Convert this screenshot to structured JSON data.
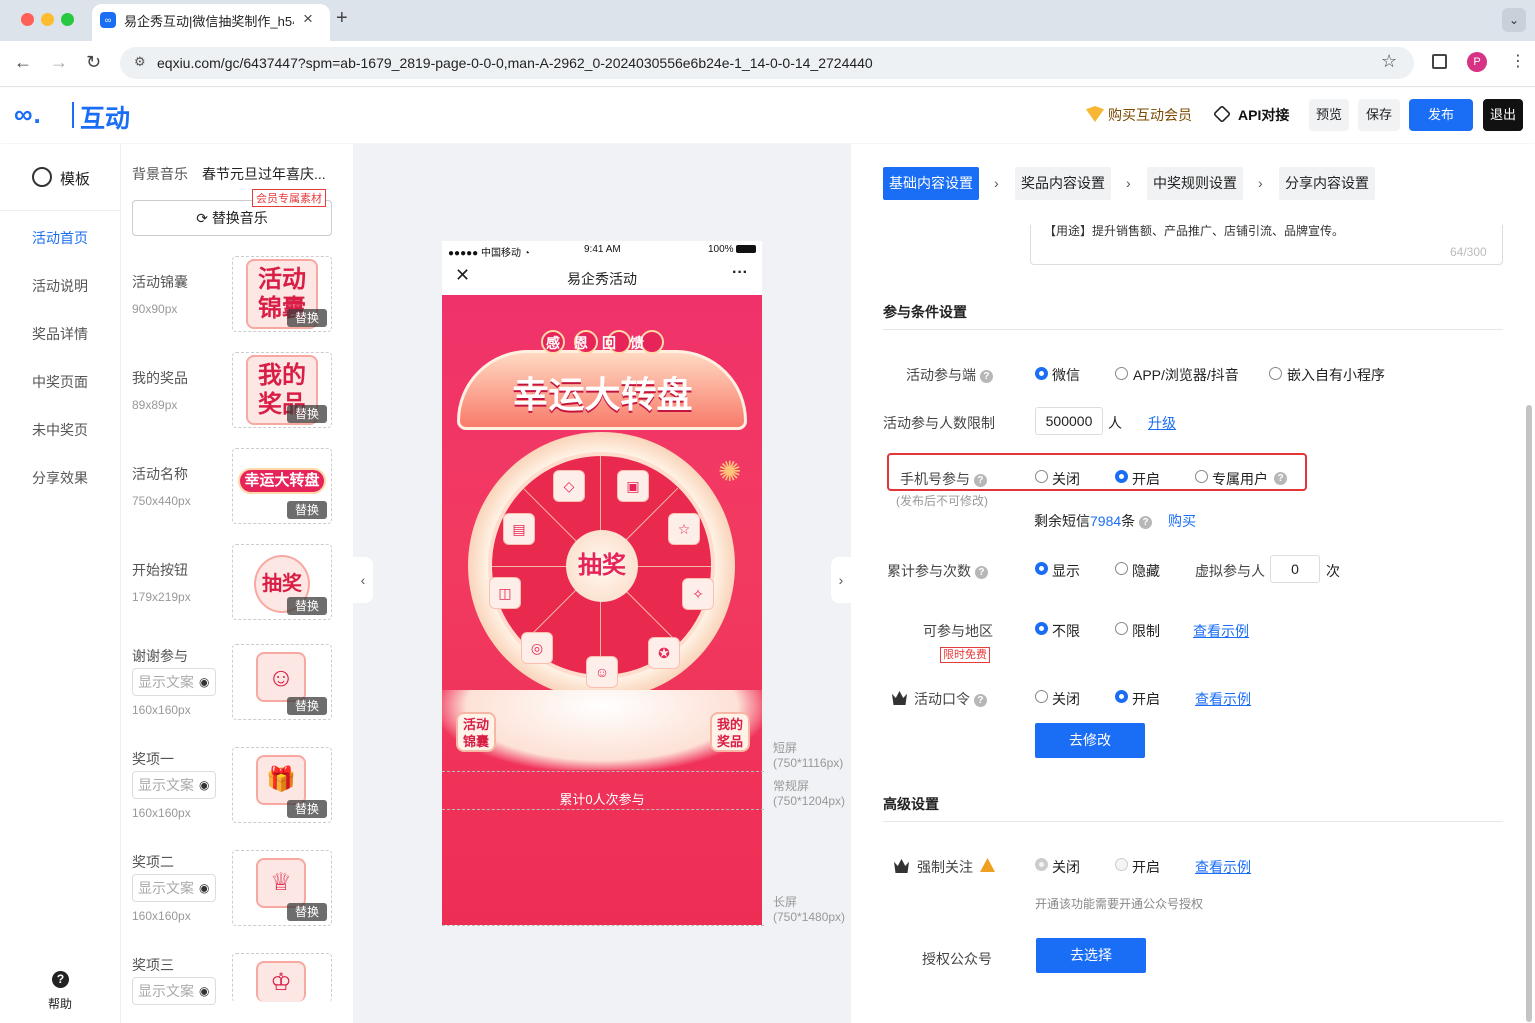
{
  "browser": {
    "tab_title": "易企秀互动|微信抽奖制作_h5小",
    "url": "eqxiu.com/gc/6437447?spm=ab-1679_2819-page-0-0-0,man-A-2962_0-2024030556e6b24e-1_14-0-0-14_2724440",
    "profile_initial": "P"
  },
  "header": {
    "logo": "互动",
    "vip": "购买互动会员",
    "api": "API对接",
    "preview": "预览",
    "save": "保存",
    "publish": "发布",
    "exit": "退出"
  },
  "leftnav": {
    "template": "模板",
    "items": [
      "活动首页",
      "活动说明",
      "奖品详情",
      "中奖页面",
      "未中奖页",
      "分享效果"
    ],
    "help": "帮助"
  },
  "assets": {
    "music_label": "背景音乐",
    "music_name": "春节元旦过年喜庆...",
    "member_tag": "会员专属素材",
    "replace_music": "替换音乐",
    "replace": "替换",
    "placeholder": "显示文案",
    "items": [
      {
        "label": "活动锦囊",
        "size": "90x90px",
        "thumb": "活动锦囊"
      },
      {
        "label": "我的奖品",
        "size": "89x89px",
        "thumb": "我的奖品"
      },
      {
        "label": "活动名称",
        "size": "750x440px",
        "thumb": "幸运大转盘"
      },
      {
        "label": "开始按钮",
        "size": "179x219px",
        "thumb": "抽奖"
      },
      {
        "label": "谢谢参与",
        "size": "160x160px",
        "thumb": "☺"
      },
      {
        "label": "奖项一",
        "size": "160x160px",
        "thumb": "🎁"
      },
      {
        "label": "奖项二",
        "size": "160x160px",
        "thumb": "♕"
      },
      {
        "label": "奖项三",
        "size": "",
        "thumb": "♔"
      }
    ]
  },
  "phone": {
    "carrier": "●●●●● 中国移动 ◔",
    "time": "9:41 AM",
    "battery": "100%",
    "title": "易企秀活动",
    "banner_tag": "感恩回馈",
    "banner_title": "幸运大转盘",
    "center": "抽奖",
    "badge_left": "活动锦囊",
    "badge_right": "我的奖品",
    "count": "累计0人次参与",
    "screens": {
      "short": "短屏",
      "short_size": "(750*1116px)",
      "normal": "常规屏",
      "normal_size": "(750*1204px)",
      "long": "长屏",
      "long_size": "(750*1480px)"
    }
  },
  "settings": {
    "steps": [
      "基础内容设置",
      "奖品内容设置",
      "中奖规则设置",
      "分享内容设置"
    ],
    "desc_text": "【用途】提升销售额、产品推广、店铺引流、品牌宣传。",
    "desc_count": "64/300",
    "section_participation": "参与条件设置",
    "platform_label": "活动参与端",
    "platform_opts": [
      "微信",
      "APP/浏览器/抖音",
      "嵌入自有小程序"
    ],
    "limit_label": "活动参与人数限制",
    "limit_value": "500000",
    "limit_unit": "人",
    "upgrade": "升级",
    "phone_label": "手机号参与",
    "phone_note": "(发布后不可修改)",
    "phone_opts": [
      "关闭",
      "开启",
      "专属用户"
    ],
    "sms_prefix": "剩余短信",
    "sms_count": "7984",
    "sms_suffix": "条",
    "buy": "购买",
    "times_label": "累计参与次数",
    "times_opts": [
      "显示",
      "隐藏"
    ],
    "virtual_label": "虚拟参与人",
    "virtual_value": "0",
    "virtual_unit": "次",
    "region_label": "可参与地区",
    "region_free": "限时免费",
    "region_opts": [
      "不限",
      "限制"
    ],
    "example": "查看示例",
    "password_label": "活动口令",
    "password_opts": [
      "关闭",
      "开启"
    ],
    "modify_btn": "去修改",
    "section_advanced": "高级设置",
    "follow_label": "强制关注",
    "follow_opts": [
      "关闭",
      "开启"
    ],
    "follow_note": "开通该功能需要开通公众号授权",
    "auth_label": "授权公众号",
    "select_btn": "去选择"
  },
  "colors": {
    "accent": "#1a6ef5",
    "danger": "#e23636",
    "stage": "#f0326b"
  }
}
